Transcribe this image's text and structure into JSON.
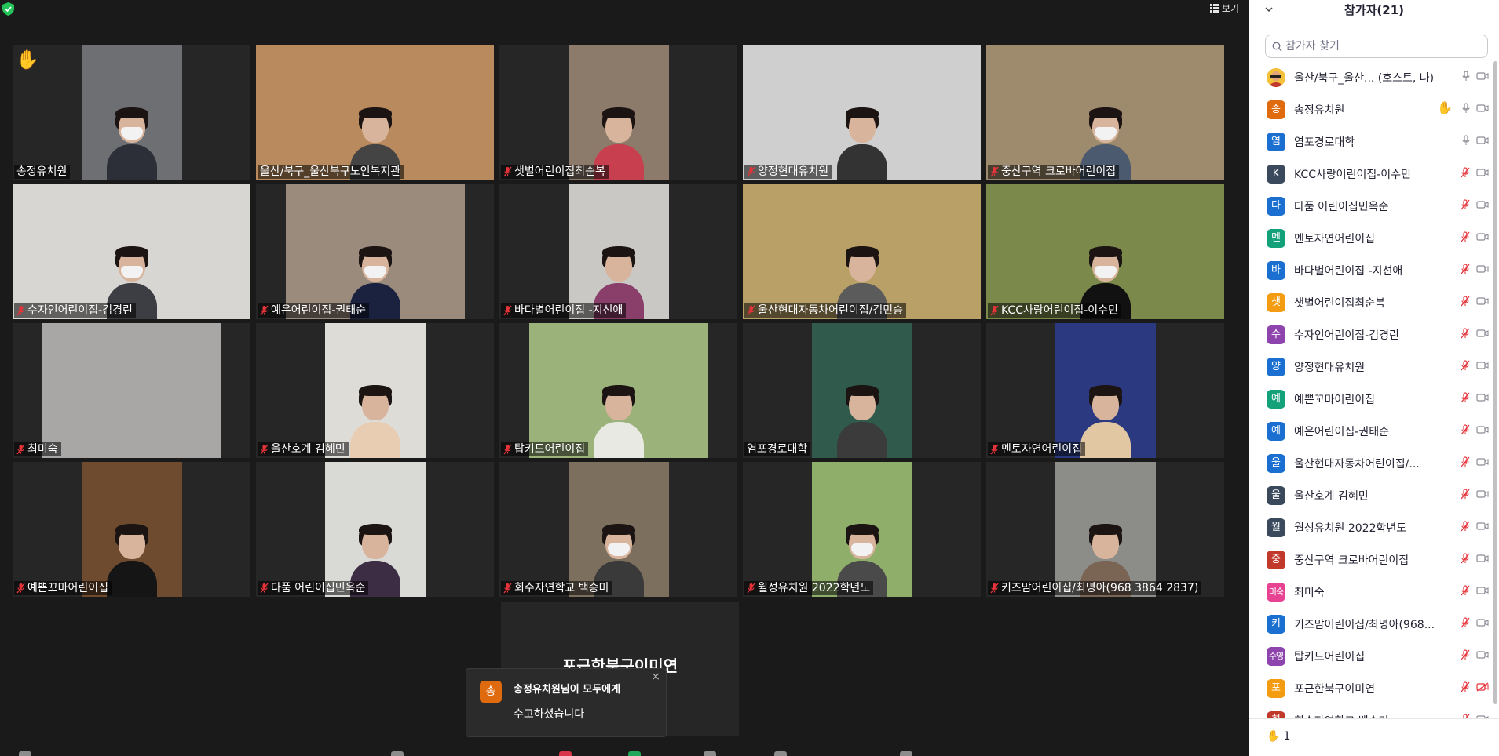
{
  "view_button": {
    "label": "보기",
    "icon": "grid-icon"
  },
  "video_grid": [
    {
      "name": "송정유치원",
      "muted": false,
      "hand_raised": true,
      "active": false,
      "bg": "#6d6f73",
      "feed": "center",
      "shirt": "#2c2f38",
      "mask": true
    },
    {
      "name": "울산/북구_울산북구노인복지관",
      "muted": false,
      "hand_raised": false,
      "active": true,
      "bg": "#b98a5e",
      "feed": "full",
      "shirt": "#444",
      "mask": false
    },
    {
      "name": "샛별어린이집최순복",
      "muted": true,
      "hand_raised": false,
      "active": false,
      "bg": "#8c7b6a",
      "feed": "center",
      "shirt": "#c83f4f",
      "mask": false
    },
    {
      "name": "양정현대유치원",
      "muted": true,
      "hand_raised": false,
      "active": false,
      "bg": "#cfcfcf",
      "feed": "full",
      "shirt": "#333",
      "mask": false
    },
    {
      "name": "중산구역 크로바어린이집",
      "muted": true,
      "hand_raised": false,
      "active": false,
      "bg": "#9e8a6c",
      "feed": "full",
      "shirt": "#4b5a6e",
      "mask": true
    },
    {
      "name": "수자인어린이집-김경린",
      "muted": true,
      "hand_raised": false,
      "active": false,
      "bg": "#d8d6d3",
      "feed": "full",
      "shirt": "#3d3d44",
      "mask": true
    },
    {
      "name": "예은어린이집-권태순",
      "muted": true,
      "hand_raised": false,
      "active": false,
      "bg": "#9b8b7d",
      "feed": "wide",
      "shirt": "#1b2240",
      "mask": true
    },
    {
      "name": "바다별어린이집 -지선애",
      "muted": true,
      "hand_raised": false,
      "active": false,
      "bg": "#c9c8c4",
      "feed": "center",
      "shirt": "#8a3f6a",
      "mask": false
    },
    {
      "name": "울산현대자동차어린이집/김민승",
      "muted": true,
      "hand_raised": false,
      "active": false,
      "bg": "#b8a066",
      "feed": "full",
      "shirt": "#5b5b5b",
      "mask": false
    },
    {
      "name": "KCC사랑어린이집-이수민",
      "muted": true,
      "hand_raised": false,
      "active": false,
      "bg": "#7b8a4a",
      "feed": "full",
      "shirt": "#111",
      "mask": true
    },
    {
      "name": "최미숙",
      "muted": true,
      "hand_raised": false,
      "active": false,
      "bg": "#a9a7a6",
      "feed": "wide",
      "shirt": "#a9a7a6",
      "mask": false,
      "empty": true
    },
    {
      "name": "울산호계 김혜민",
      "muted": true,
      "hand_raised": false,
      "active": false,
      "bg": "#dedcd7",
      "feed": "center",
      "shirt": "#e8cdb3",
      "mask": false
    },
    {
      "name": "탑키드어린이집",
      "muted": true,
      "hand_raised": false,
      "active": false,
      "bg": "#9bb37a",
      "feed": "wide",
      "shirt": "#e9e9e3",
      "mask": false
    },
    {
      "name": "염포경로대학",
      "muted": false,
      "hand_raised": false,
      "active": false,
      "bg": "#2f5a4c",
      "feed": "center",
      "shirt": "#3b3b3b",
      "mask": false
    },
    {
      "name": "멘토자연어린이집",
      "muted": true,
      "hand_raised": false,
      "active": false,
      "bg": "#2b3a80",
      "feed": "center",
      "shirt": "#e1c8a2",
      "mask": false
    },
    {
      "name": "예쁜꼬마어린이집",
      "muted": true,
      "hand_raised": false,
      "active": false,
      "bg": "#6e4a2e",
      "feed": "center",
      "shirt": "#151515",
      "mask": false
    },
    {
      "name": "다품 어린이집민옥순",
      "muted": true,
      "hand_raised": false,
      "active": false,
      "bg": "#d9d9d6",
      "feed": "center",
      "shirt": "#3c2c44",
      "mask": false
    },
    {
      "name": "회수자연학교 백승미",
      "muted": true,
      "hand_raised": false,
      "active": false,
      "bg": "#7c6f5d",
      "feed": "center",
      "shirt": "#3a3a3a",
      "mask": true
    },
    {
      "name": "월성유치원 2022학년도",
      "muted": true,
      "hand_raised": false,
      "active": false,
      "bg": "#8fae6a",
      "feed": "center",
      "shirt": "#4a4a4a",
      "mask": true
    },
    {
      "name": "키즈맘어린이집/최명아(968 3864 2837)",
      "muted": true,
      "hand_raised": false,
      "active": false,
      "bg": "#8c8d88",
      "feed": "center",
      "shirt": "#7a6555",
      "mask": false
    }
  ],
  "name_only_tile": {
    "name": "포근한북구이미연"
  },
  "chat_toast": {
    "avatar": "송",
    "avatar_color": "#e06a0e",
    "from": "송정유치원님이 모두에게",
    "message": "수고하셨습니다",
    "close": "×"
  },
  "panel": {
    "title": "참가자(21)",
    "search_placeholder": "참가자 찾기",
    "participants": [
      {
        "avatar": "",
        "avatar_img": true,
        "color": "#f3c13a",
        "name": "울산/북구_울산... (호스트, 나)",
        "hand": false,
        "mic": "on",
        "video": "on"
      },
      {
        "avatar": "송",
        "color": "#e06a0e",
        "name": "송정유치원",
        "hand": true,
        "mic": "on",
        "video": "on"
      },
      {
        "avatar": "염",
        "color": "#1a6fd1",
        "name": "염포경로대학",
        "hand": false,
        "mic": "on",
        "video": "on"
      },
      {
        "avatar": "K",
        "color": "#3a4a5c",
        "name": "KCC사랑어린이집-이수민",
        "hand": false,
        "mic": "muted",
        "video": "on"
      },
      {
        "avatar": "다",
        "color": "#1a6fd1",
        "name": "다품 어린이집민옥순",
        "hand": false,
        "mic": "muted",
        "video": "on"
      },
      {
        "avatar": "멘",
        "color": "#13a17a",
        "name": "멘토자연어린이집",
        "hand": false,
        "mic": "muted",
        "video": "on"
      },
      {
        "avatar": "바",
        "color": "#1a6fd1",
        "name": "바다별어린이집 -지선애",
        "hand": false,
        "mic": "muted",
        "video": "on"
      },
      {
        "avatar": "샛",
        "color": "#f39c12",
        "name": "샛별어린이집최순복",
        "hand": false,
        "mic": "muted",
        "video": "on"
      },
      {
        "avatar": "수",
        "color": "#8e44ad",
        "name": "수자인어린이집-김경린",
        "hand": false,
        "mic": "muted",
        "video": "on"
      },
      {
        "avatar": "양",
        "color": "#1a6fd1",
        "name": "양정현대유치원",
        "hand": false,
        "mic": "muted",
        "video": "on"
      },
      {
        "avatar": "예",
        "color": "#13a17a",
        "name": "예쁜꼬마어린이집",
        "hand": false,
        "mic": "muted",
        "video": "on"
      },
      {
        "avatar": "예",
        "color": "#1a6fd1",
        "name": "예은어린이집-권태순",
        "hand": false,
        "mic": "muted",
        "video": "on"
      },
      {
        "avatar": "울",
        "color": "#1a6fd1",
        "name": "울산현대자동차어린이집/...",
        "hand": false,
        "mic": "muted",
        "video": "on"
      },
      {
        "avatar": "울",
        "color": "#3a4a5c",
        "name": "울산호계 김혜민",
        "hand": false,
        "mic": "muted",
        "video": "on"
      },
      {
        "avatar": "월",
        "color": "#3a4a5c",
        "name": "월성유치원 2022학년도",
        "hand": false,
        "mic": "muted",
        "video": "on"
      },
      {
        "avatar": "중",
        "color": "#c0392b",
        "name": "중산구역 크로바어린이집",
        "hand": false,
        "mic": "muted",
        "video": "on"
      },
      {
        "avatar": "미숙",
        "color": "#e84393",
        "name": "최미숙",
        "hand": false,
        "mic": "muted",
        "video": "on"
      },
      {
        "avatar": "키",
        "color": "#1a6fd1",
        "name": "키즈맘어린이집/최명아(968...",
        "hand": false,
        "mic": "muted",
        "video": "on"
      },
      {
        "avatar": "수영",
        "color": "#8e44ad",
        "name": "탑키드어린이집",
        "hand": false,
        "mic": "muted",
        "video": "on"
      },
      {
        "avatar": "포",
        "color": "#f39c12",
        "name": "포근한북구이미연",
        "hand": false,
        "mic": "muted",
        "video": "off"
      },
      {
        "avatar": "회",
        "color": "#c0392b",
        "name": "회수자연학교 백승미",
        "hand": false,
        "mic": "muted",
        "video": "on"
      }
    ],
    "footer_hand_count": "1"
  }
}
